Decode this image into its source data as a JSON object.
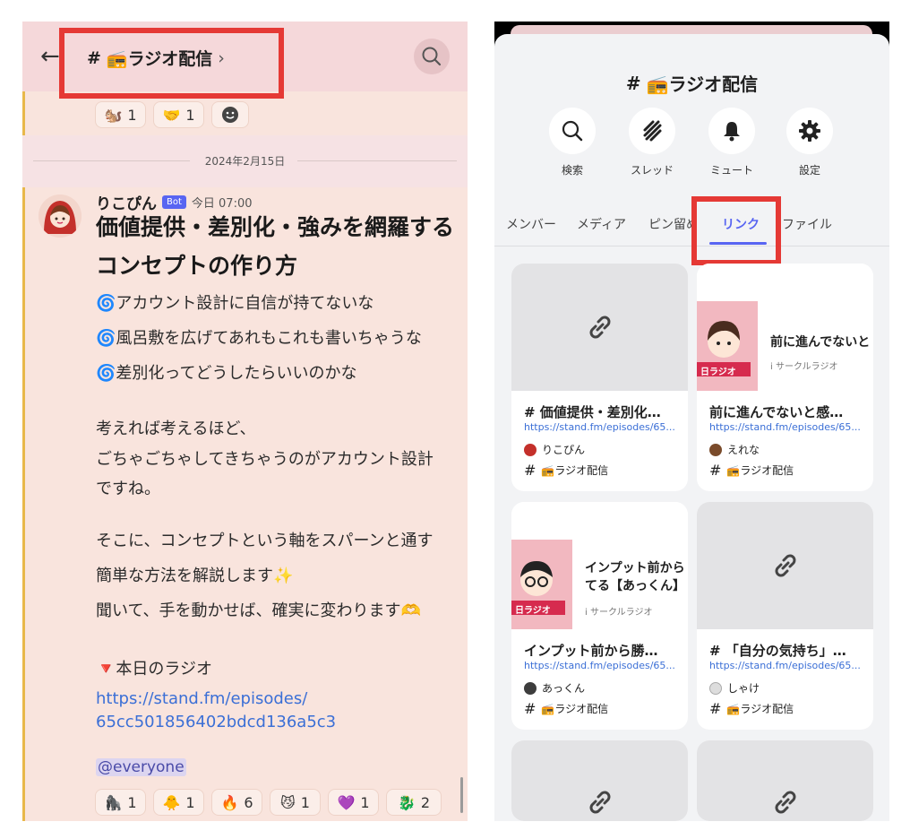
{
  "left": {
    "back_glyph": "←",
    "channel_title": "📻ラジオ配信",
    "channel_chevron": "›",
    "hash": "#",
    "top_reactions": [
      {
        "emoji": "🐿️",
        "count": "1"
      },
      {
        "emoji": "🤝",
        "count": "1"
      }
    ],
    "date_divider": "2024年2月15日",
    "author": "りこぴん",
    "bot_badge": "Bot",
    "time": "今日 07:00",
    "message_title": "価値提供・差別化・強みを網羅するコンセプトの作り方",
    "lines": [
      "🌀アカウント設計に自信が持てないな",
      "🌀風呂敷を広げてあれもこれも書いちゃうな",
      "🌀差別化ってどうしたらいいのかな",
      "考えれば考えるほど、",
      "ごちゃごちゃしてきちゃうのがアカウント設計",
      "ですね。",
      "そこに、コンセプトという軸をスパーンと通す",
      "簡単な方法を解説します✨",
      "聞いて、手を動かせば、確実に変わります🫶",
      "🔻本日のラジオ"
    ],
    "link_line1": "https://stand.fm/episodes/",
    "link_line2": "65cc501856402bdcd136a5c3",
    "mention": "@everyone",
    "bottom_reactions": [
      {
        "emoji": "🦍",
        "count": "1"
      },
      {
        "emoji": "🐥",
        "count": "1"
      },
      {
        "emoji": "🔥",
        "count": "6"
      },
      {
        "emoji": "😼",
        "count": "1"
      },
      {
        "emoji": "💜",
        "count": "1"
      },
      {
        "emoji": "🐉",
        "count": "2"
      }
    ]
  },
  "right": {
    "sheet_title": "📻ラジオ配信",
    "hash": "#",
    "actions": [
      {
        "label": "検索",
        "icon": "search-icon"
      },
      {
        "label": "スレッド",
        "icon": "threads-icon"
      },
      {
        "label": "ミュート",
        "icon": "bell-icon"
      },
      {
        "label": "設定",
        "icon": "gear-icon"
      }
    ],
    "tabs": [
      "メンバー",
      "メディア",
      "ピン留め",
      "リンク",
      "ファイル"
    ],
    "active_tab": "リンク",
    "cards": [
      {
        "title": "# 価値提供・差別化…",
        "url": "https://stand.fm/episodes/65...",
        "user": "りこぴん",
        "channel": "📻ラジオ配信"
      },
      {
        "title": "前に進んでないと感…",
        "url": "https://stand.fm/episodes/65...",
        "user": "えれな",
        "channel": "📻ラジオ配信",
        "thumb_title": "前に進んでないと",
        "thumb_sub": "i サークルラジオ",
        "thumb_banner": "日ラジオ"
      },
      {
        "title": "インプット前から勝…",
        "url": "https://stand.fm/episodes/65...",
        "user": "あっくん",
        "channel": "📻ラジオ配信",
        "thumb_title_1": "インプット前から",
        "thumb_title_2": "てる【あっくん】",
        "thumb_sub": "i サークルラジオ",
        "thumb_banner": "日ラジオ"
      },
      {
        "title": "# 「自分の気持ち」…",
        "url": "https://stand.fm/episodes/65...",
        "user": "しゃけ",
        "channel": "📻ラジオ配信"
      }
    ]
  },
  "colors": {
    "accent": "#5865f2",
    "highlight_box": "#e53935",
    "link": "#3b6fd6"
  }
}
